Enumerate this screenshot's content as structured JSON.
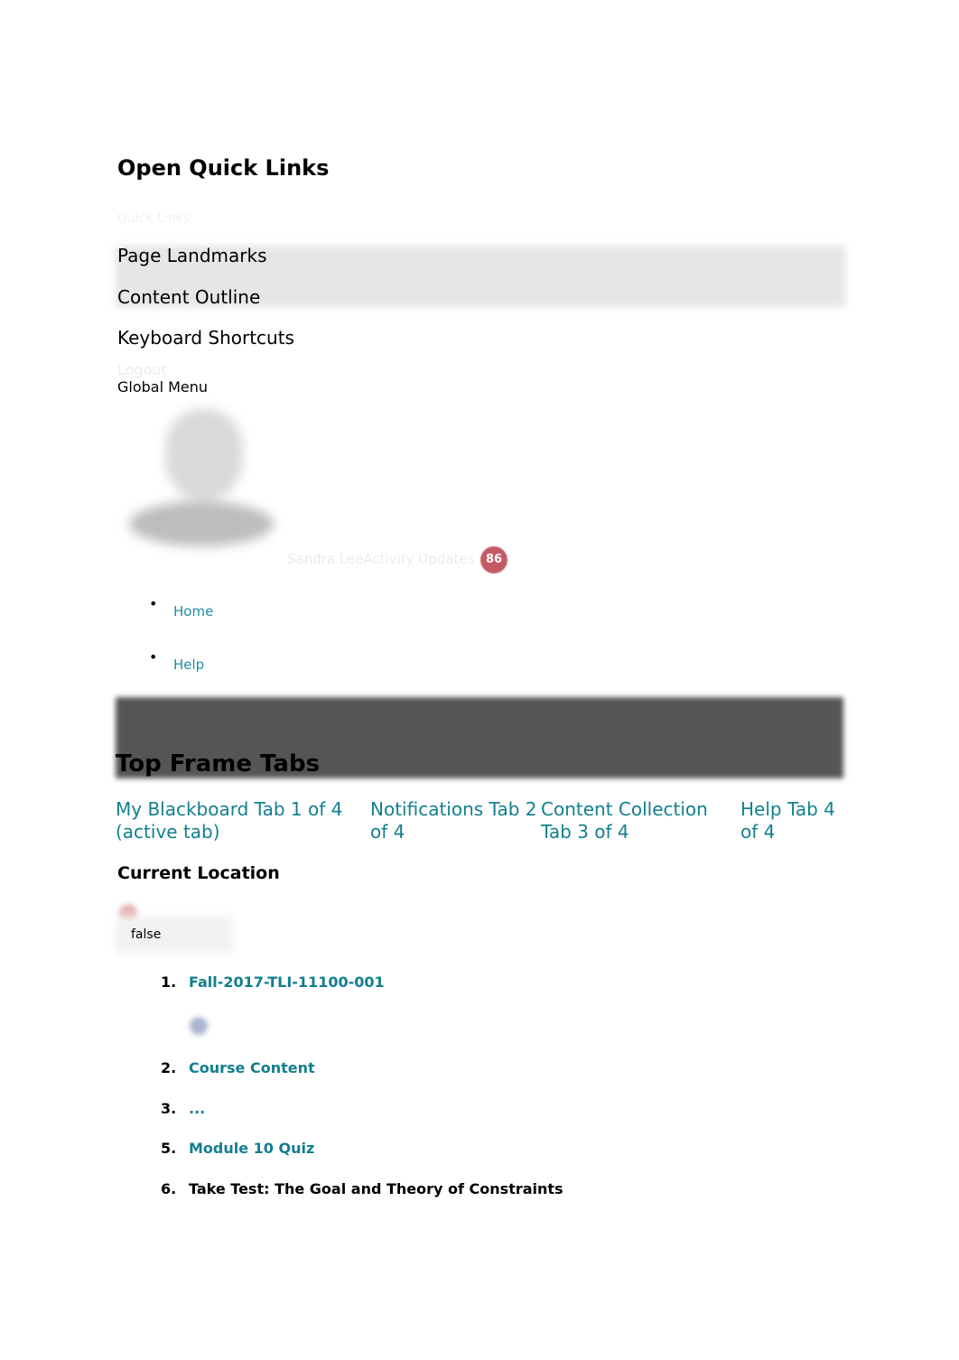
{
  "quick_links": {
    "heading": "Open Quick Links",
    "faint_label": "Quick Links",
    "items": [
      {
        "label": "Page Landmarks"
      },
      {
        "label": "Content Outline"
      },
      {
        "label": "Keyboard Shortcuts"
      }
    ],
    "logout_label": "Logout"
  },
  "global_menu": {
    "label": "Global Menu",
    "user_name_activity": "Sandra LeeActivity Updates",
    "activity_count": "86",
    "badge_color": "#c45a64"
  },
  "nav": {
    "items": [
      {
        "label": "Home"
      },
      {
        "label": "Help"
      }
    ],
    "link_color": "#1d8ea3"
  },
  "top_frame_tabs": {
    "heading": "Top Frame Tabs",
    "tabs": [
      {
        "label": "My Blackboard Tab 1 of 4 (active tab)",
        "active": true
      },
      {
        "label": "Notifications Tab 2 of 4",
        "active": false
      },
      {
        "label": "Content Collection Tab 3 of 4",
        "active": false
      },
      {
        "label": "Help Tab 4 of 4",
        "active": false
      }
    ],
    "tab_color": "#127f8f"
  },
  "current_location": {
    "heading": "Current Location",
    "toggle_value": "false",
    "breadcrumbs": [
      {
        "num": "1.",
        "label": "Fall-2017-TLI-11100-001",
        "link": true
      },
      {
        "num": "2.",
        "label": "Course Content",
        "link": true
      },
      {
        "num": "3.",
        "label": "...",
        "link": true
      },
      {
        "num": "5.",
        "label": "Module 10 Quiz",
        "link": true
      },
      {
        "num": "6.",
        "label": "Take Test: The Goal and Theory of Constraints",
        "link": false
      }
    ]
  }
}
